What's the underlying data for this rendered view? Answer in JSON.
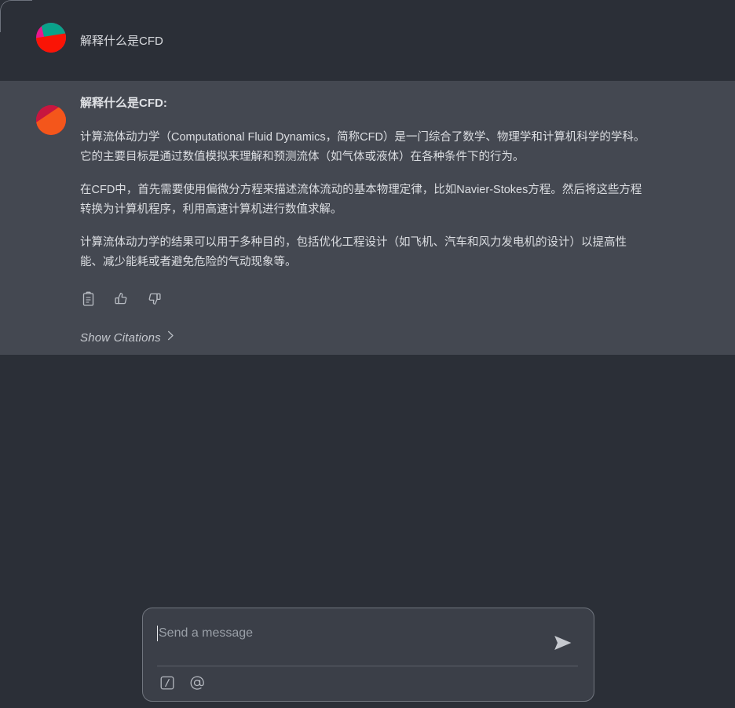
{
  "theme": {
    "user_row_bg": "#2b2f37",
    "assistant_row_bg": "#444851",
    "page_bg": "#2b2f37",
    "text_primary": "#dcdee2",
    "text_muted": "#9aa0a8",
    "composer_bg": "#3b3f48",
    "composer_border": "#70757e"
  },
  "conversation": {
    "user_message": {
      "avatar_name": "user-avatar",
      "avatar_colors": [
        "#e8188f",
        "#09a28a",
        "#fa1405"
      ],
      "text": "解释什么是CFD"
    },
    "assistant_message": {
      "avatar_name": "assistant-avatar",
      "avatar_colors": [
        "#cc1a44",
        "#f4561b"
      ],
      "title": "解释什么是CFD:",
      "paragraphs": [
        "计算流体动力学（Computational Fluid Dynamics，简称CFD）是一门综合了数学、物理学和计算机科学的学科。它的主要目标是通过数值模拟来理解和预测流体（如气体或液体）在各种条件下的行为。",
        "在CFD中，首先需要使用偏微分方程来描述流体流动的基本物理定律，比如Navier-Stokes方程。然后将这些方程转换为计算机程序，利用高速计算机进行数值求解。",
        "计算流体动力学的结果可以用于多种目的，包括优化工程设计（如飞机、汽车和风力发电机的设计）以提高性能、减少能耗或者避免危险的气动现象等。"
      ],
      "actions": [
        {
          "name": "copy-icon",
          "label": "Copy"
        },
        {
          "name": "thumbs-up-icon",
          "label": "Thumbs up"
        },
        {
          "name": "thumbs-down-icon",
          "label": "Thumbs down"
        }
      ],
      "citations": {
        "label": "Show Citations",
        "chevron": "chevron-right-icon"
      }
    }
  },
  "composer": {
    "placeholder": "Send a message",
    "value": "",
    "send_button": {
      "name": "send-icon",
      "label": "Send"
    },
    "tools": [
      {
        "name": "slash-command-icon",
        "glyph": "/",
        "label": "Slash commands"
      },
      {
        "name": "mention-icon",
        "glyph": "@",
        "label": "Mention"
      }
    ]
  }
}
